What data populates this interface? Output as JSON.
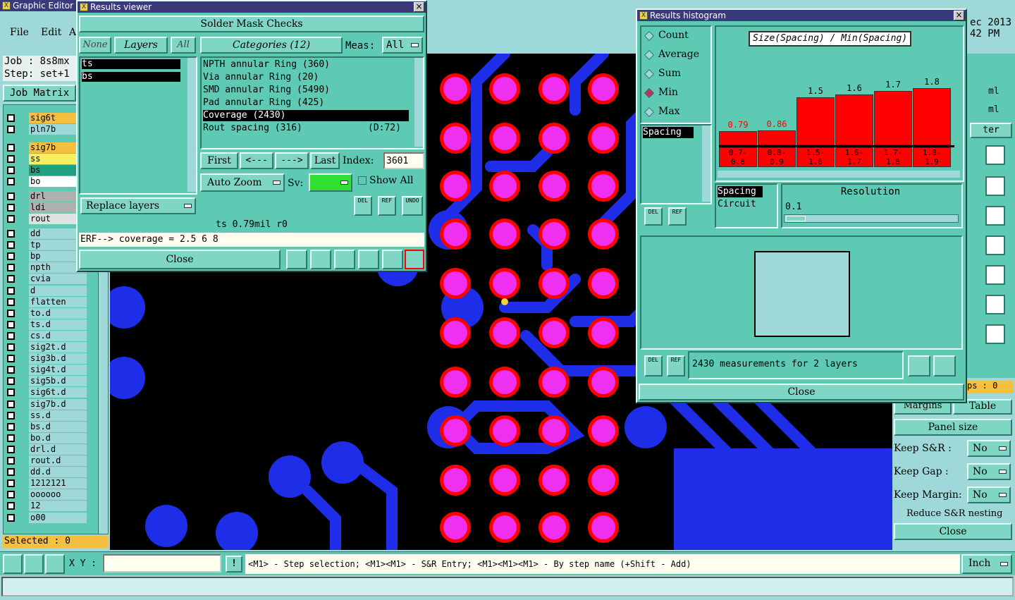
{
  "main": {
    "title": "Graphic Editor ",
    "menu": [
      "File",
      "Edit",
      "A"
    ],
    "job_label": "Job : 8s8mx",
    "step_label": "Step: set+1",
    "job_matrix": "Job Matrix",
    "date_partial": "ec 2013",
    "time_partial": "42 PM",
    "selected": "Selected : 0",
    "xy_label": "X Y :",
    "xy_value": "",
    "status_hint": "<M1> - Step selection; <M1><M1> - S&R Entry; <M1><M1><M1> - By step name (+Shift - Add)",
    "units": "Inch"
  },
  "layers": [
    {
      "name": "sig6t",
      "color": "#f5c040"
    },
    {
      "name": "pln7b",
      "color": "#9fd8d8"
    },
    {
      "name": "sig7b",
      "color": "#f5c040"
    },
    {
      "name": "ss",
      "color": "#f5f060"
    },
    {
      "name": "bs",
      "color": "#1fa080"
    },
    {
      "name": "bo",
      "color": "#ffffff"
    },
    {
      "name": "drl",
      "color": "#b0b0b0"
    },
    {
      "name": "ldi",
      "color": "#b0b0b0"
    },
    {
      "name": "rout",
      "color": "#e0e0e0"
    },
    {
      "name": "dd",
      "color": "#9fd8d8"
    },
    {
      "name": "tp",
      "color": "#9fd8d8"
    },
    {
      "name": "bp",
      "color": "#9fd8d8"
    },
    {
      "name": "npth",
      "color": "#9fd8d8"
    },
    {
      "name": "cvia",
      "color": "#9fd8d8"
    },
    {
      "name": "d",
      "color": "#9fd8d8"
    },
    {
      "name": "flatten",
      "color": "#9fd8d8"
    },
    {
      "name": "to.d",
      "color": "#9fd8d8"
    },
    {
      "name": "ts.d",
      "color": "#9fd8d8"
    },
    {
      "name": "cs.d",
      "color": "#9fd8d8"
    },
    {
      "name": "sig2t.d",
      "color": "#9fd8d8"
    },
    {
      "name": "sig3b.d",
      "color": "#9fd8d8"
    },
    {
      "name": "sig4t.d",
      "color": "#9fd8d8"
    },
    {
      "name": "sig5b.d",
      "color": "#9fd8d8"
    },
    {
      "name": "sig6t.d",
      "color": "#9fd8d8"
    },
    {
      "name": "sig7b.d",
      "color": "#9fd8d8"
    },
    {
      "name": "ss.d",
      "color": "#9fd8d8"
    },
    {
      "name": "bs.d",
      "color": "#9fd8d8"
    },
    {
      "name": "bo.d",
      "color": "#9fd8d8"
    },
    {
      "name": "drl.d",
      "color": "#9fd8d8"
    },
    {
      "name": "rout.d",
      "color": "#9fd8d8"
    },
    {
      "name": "dd.d",
      "color": "#9fd8d8"
    },
    {
      "name": "1212121",
      "color": "#9fd8d8"
    },
    {
      "name": "oooooo",
      "color": "#9fd8d8"
    },
    {
      "name": "12",
      "color": "#9fd8d8"
    },
    {
      "name": "o00",
      "color": "#9fd8d8"
    }
  ],
  "results": {
    "title": "Results viewer",
    "header": "Solder Mask Checks",
    "btn_none": "None",
    "btn_layers": "Layers",
    "btn_all": "All",
    "categories_btn": "Categories (12)",
    "meas_label": "Meas:",
    "meas_value": "All",
    "layer_items": [
      "ts",
      "bs"
    ],
    "categories": [
      "NPTH annular Ring (360)",
      "Via annular Ring (20)",
      "SMD annular Ring (5490)",
      "Pad annular Ring (425)",
      "Coverage (2430)",
      "Rout spacing (316)"
    ],
    "cat_extra": "(D:72)",
    "nav_first": "First",
    "nav_prev": "<---",
    "nav_next": "--->",
    "nav_last": "Last",
    "index_label": "Index:",
    "index_value": "3601",
    "auto_zoom": "Auto Zoom",
    "sv_label": "Sv:",
    "show_all": "Show All",
    "replace_layers": "Replace layers",
    "del": "DEL",
    "ref": "REF",
    "undo": "UNDO",
    "info": "ts 0.79mil  r0",
    "erf": "ERF--> coverage = 2.5 6 8",
    "close": "Close"
  },
  "histogram": {
    "title": "Results histogram",
    "options": [
      "Count",
      "Average",
      "Sum",
      "Min",
      "Max"
    ],
    "selected_option": "Min",
    "attr_item": "Spacing",
    "chart_title": "Size(Spacing) / Min(Spacing)",
    "bars": [
      {
        "value": 0.79,
        "range_top": "0.7-",
        "range_bot": "0.8"
      },
      {
        "value": 0.86,
        "range_top": "0.8-",
        "range_bot": "0.9"
      },
      {
        "value": 1.5,
        "range_top": "1.5-",
        "range_bot": "1.6"
      },
      {
        "value": 1.6,
        "range_top": "1.6-",
        "range_bot": "1.7"
      },
      {
        "value": 1.7,
        "range_top": "1.7-",
        "range_bot": "1.8"
      },
      {
        "value": 1.8,
        "range_top": "1.8-",
        "range_bot": "1.9"
      }
    ],
    "bar_labels": [
      "0.79",
      "0.86",
      "1.5",
      "1.6",
      "1.7",
      "1.8"
    ],
    "mode_items": [
      "Spacing",
      "Circuit"
    ],
    "resolution_label": "Resolution",
    "resolution_value": "0.1",
    "del": "DEL",
    "ref": "REF",
    "summary": "2430 measurements for 2 layers",
    "close": "Close"
  },
  "right_panel": {
    "unit1": "ml",
    "unit2": "ml",
    "iter": "ter",
    "ops": "ps : 0",
    "margins": "Margins",
    "table": "Table",
    "panel_size": "Panel size",
    "keep_sr": "Keep S&R  :",
    "keep_sr_val": "No",
    "keep_gap": "Keep Gap   :",
    "keep_gap_val": "No",
    "keep_margin": "Keep Margin:",
    "keep_margin_val": "No",
    "reduce": "Reduce S&R nesting",
    "close": "Close"
  }
}
